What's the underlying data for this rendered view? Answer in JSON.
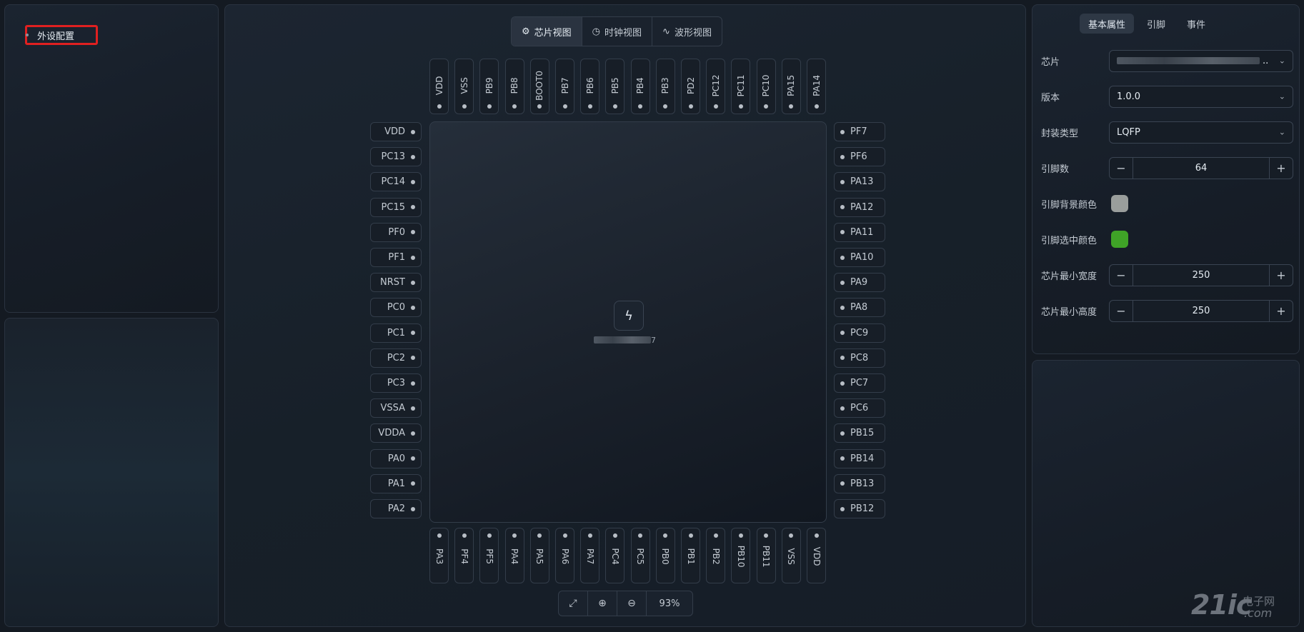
{
  "left": {
    "tree_item": "外设配置"
  },
  "view_tabs": [
    {
      "label": "芯片视图",
      "icon": "chip-icon"
    },
    {
      "label": "时钟视图",
      "icon": "clock-icon"
    },
    {
      "label": "波形视图",
      "icon": "waveform-icon"
    }
  ],
  "pins": {
    "top": [
      "VDD",
      "VSS",
      "PB9",
      "PB8",
      "BOOT0",
      "PB7",
      "PB6",
      "PB5",
      "PB4",
      "PB3",
      "PD2",
      "PC12",
      "PC11",
      "PC10",
      "PA15",
      "PA14"
    ],
    "left": [
      "VDD",
      "PC13",
      "PC14",
      "PC15",
      "PF0",
      "PF1",
      "NRST",
      "PC0",
      "PC1",
      "PC2",
      "PC3",
      "VSSA",
      "VDDA",
      "PA0",
      "PA1",
      "PA2"
    ],
    "right": [
      "PF7",
      "PF6",
      "PA13",
      "PA12",
      "PA11",
      "PA10",
      "PA9",
      "PA8",
      "PC9",
      "PC8",
      "PC7",
      "PC6",
      "PB15",
      "PB14",
      "PB13",
      "PB12"
    ],
    "bottom": [
      "PA3",
      "PF4",
      "PF5",
      "PA4",
      "PA5",
      "PA6",
      "PA7",
      "PC4",
      "PC5",
      "PB0",
      "PB1",
      "PB2",
      "PB10",
      "PB11",
      "VSS",
      "VDD"
    ]
  },
  "chip": {
    "icon": "lightning-icon",
    "name_suffix": "7"
  },
  "zoom": {
    "level": "93%"
  },
  "right": {
    "tabs": [
      "基本属性",
      "引脚",
      "事件"
    ],
    "chip_label": "芯片",
    "chip_value": "",
    "version_label": "版本",
    "version_value": "1.0.0",
    "package_label": "封装类型",
    "package_value": "LQFP",
    "pin_count_label": "引脚数",
    "pin_count_value": "64",
    "pin_bg_color_label": "引脚背景颜色",
    "pin_bg_color": "#9a9e9c",
    "pin_sel_color_label": "引脚选中颜色",
    "pin_sel_color": "#3fa327",
    "min_width_label": "芯片最小宽度",
    "min_width_value": "250",
    "min_height_label": "芯片最小高度",
    "min_height_value": "250"
  },
  "watermark": {
    "main": "21ic",
    "cn": "电子网",
    "com": ".com"
  }
}
